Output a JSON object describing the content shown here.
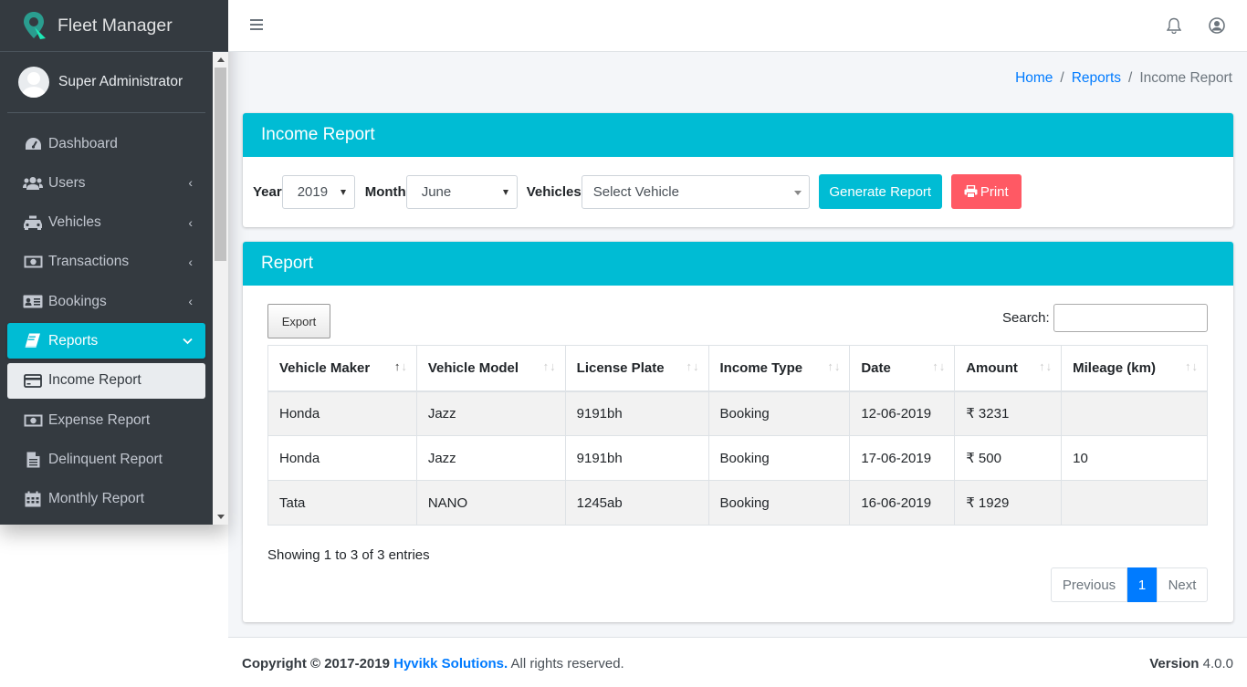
{
  "app": {
    "name": "Fleet Manager"
  },
  "user": {
    "name": "Super Administrator"
  },
  "sidebar": {
    "items": [
      {
        "label": "Dashboard",
        "icon": "tachometer-icon"
      },
      {
        "label": "Users",
        "icon": "users-icon"
      },
      {
        "label": "Vehicles",
        "icon": "taxi-icon"
      },
      {
        "label": "Transactions",
        "icon": "money-icon"
      },
      {
        "label": "Bookings",
        "icon": "address-card-icon"
      },
      {
        "label": "Reports",
        "icon": "book-icon"
      },
      {
        "label": "Income Report",
        "icon": "credit-card-icon"
      },
      {
        "label": "Expense Report",
        "icon": "money-icon"
      },
      {
        "label": "Delinquent Report",
        "icon": "file-icon"
      },
      {
        "label": "Monthly Report",
        "icon": "calendar-icon"
      }
    ]
  },
  "breadcrumb": {
    "home": "Home",
    "reports": "Reports",
    "current": "Income Report",
    "sep": "/"
  },
  "income_card": {
    "title": "Income Report",
    "year_label": "Year",
    "year_value": "2019",
    "month_label": "Month",
    "month_value": "June",
    "vehicles_label": "Vehicles",
    "vehicles_value": "Select Vehicle",
    "generate_label": "Generate Report",
    "print_label": "Print"
  },
  "report_card": {
    "title": "Report",
    "export_label": "Export",
    "search_label": "Search:",
    "columns": [
      "Vehicle Maker",
      "Vehicle Model",
      "License Plate",
      "Income Type",
      "Date",
      "Amount",
      "Mileage (km)"
    ],
    "rows": [
      [
        "Honda",
        "Jazz",
        "9191bh",
        "Booking",
        "12-06-2019",
        "₹ 3231",
        ""
      ],
      [
        "Honda",
        "Jazz",
        "9191bh",
        "Booking",
        "17-06-2019",
        "₹ 500",
        "10"
      ],
      [
        "Tata",
        "NANO",
        "1245ab",
        "Booking",
        "16-06-2019",
        "₹ 1929",
        ""
      ]
    ],
    "info": "Showing 1 to 3 of 3 entries",
    "pager": {
      "previous": "Previous",
      "page": "1",
      "next": "Next"
    }
  },
  "footer": {
    "copyright": "Copyright © 2017-2019",
    "company": "Hyvikk Solutions.",
    "rights": "All rights reserved.",
    "version_label": "Version",
    "version_value": "4.0.0"
  },
  "colors": {
    "accent": "#00bcd4",
    "danger": "#ff5964",
    "primary": "#007bff",
    "sidebar": "#343a40"
  }
}
